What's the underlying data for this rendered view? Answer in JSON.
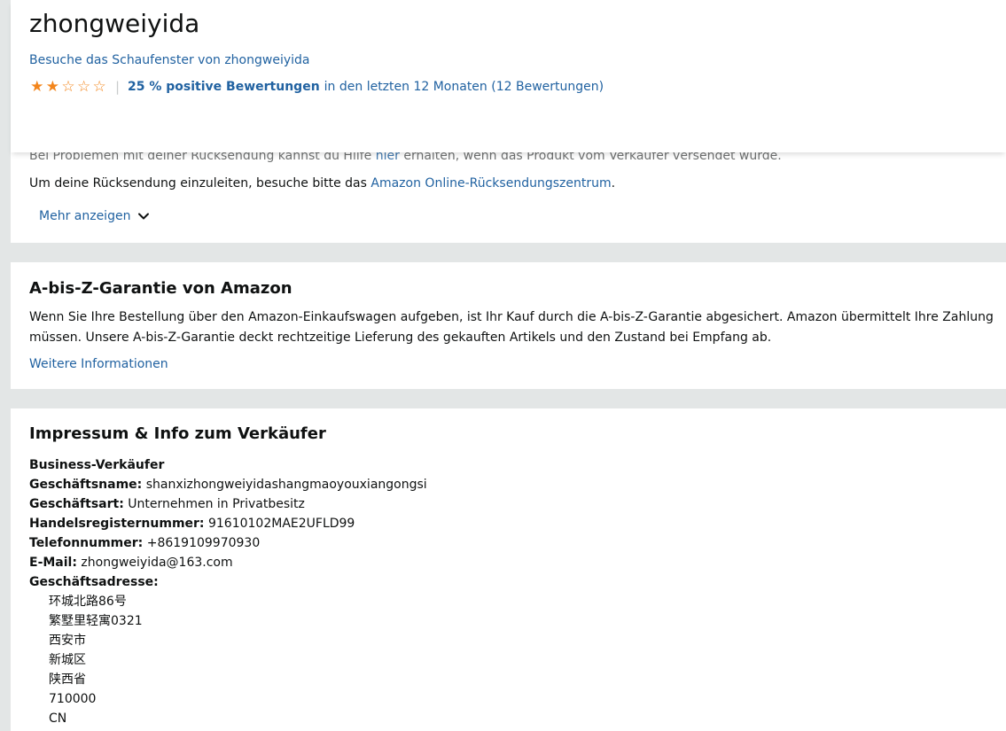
{
  "header": {
    "seller_name": "zhongweiyida",
    "storefront_link": "Besuche das Schaufenster von zhongweiyida",
    "stars_filled": 2,
    "stars_total": 5,
    "rating_positive": "25 % positive Bewertungen",
    "rating_rest": "in den letzten 12 Monaten (12 Bewertungen)",
    "star_color": "#f3851b"
  },
  "returns": {
    "faded_before": "Bei Problemen mit deiner Rücksendung kannst du Hilfe ",
    "faded_link": "hier",
    "faded_after": " erhalten, wenn das Produkt vom Verkäufer versendet wurde.",
    "line_before": "Um deine Rücksendung einzuleiten, besuche bitte das ",
    "line_link": "Amazon Online-Rücksendungszentrum",
    "line_after": ".",
    "more_label": "Mehr anzeigen"
  },
  "guarantee": {
    "title": "A-bis-Z-Garantie von Amazon",
    "line1": "Wenn Sie Ihre Bestellung über den Amazon-Einkaufswagen aufgeben, ist Ihr Kauf durch die A-bis-Z-Garantie abgesichert. Amazon übermittelt Ihre Zahlung",
    "line2": "müssen. Unsere A-bis-Z-Garantie deckt rechtzeitige Lieferung des gekauften Artikels und den Zustand bei Empfang ab.",
    "link": "Weitere Informationen"
  },
  "impressum": {
    "title": "Impressum & Info zum Verkäufer",
    "business_label": "Business-Verkäufer",
    "fields": [
      {
        "label": "Geschäftsname:",
        "value": " shanxizhongweiyidashangmaoyouxiangongsi"
      },
      {
        "label": "Geschäftsart:",
        "value": " Unternehmen in Privatbesitz"
      },
      {
        "label": "Handelsregisternummer:",
        "value": " 91610102MAE2UFLD99"
      },
      {
        "label": "Telefonnummer:",
        "value": " +8619109970930"
      },
      {
        "label": "E-Mail:",
        "value": " zhongweiyida@163.com"
      }
    ],
    "address_label": "Geschäftsadresse:",
    "address": [
      "环城北路86号",
      "繁墅里轻寓0321",
      "西安市",
      "新城区",
      "陕西省",
      "710000",
      "CN"
    ]
  }
}
